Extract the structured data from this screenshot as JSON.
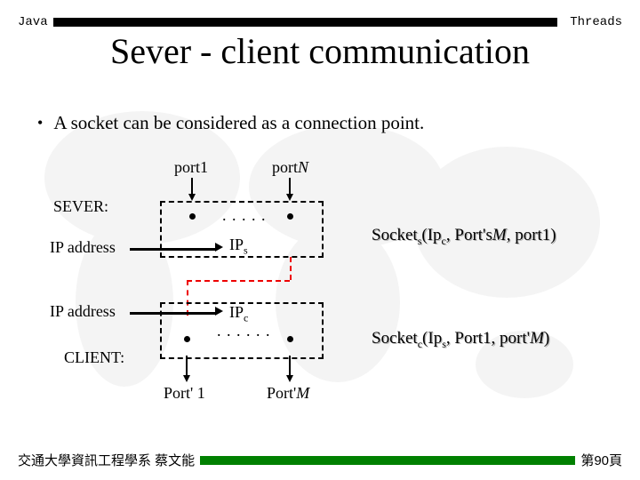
{
  "header": {
    "left": "Java",
    "right": "Threads"
  },
  "title": "Sever - client communication",
  "bullet": "A socket can be considered as a connection point.",
  "labels": {
    "port1": "port1",
    "portN_prefix": "port",
    "portN_suffix": "N",
    "sever": "SEVER:",
    "ip_address": "IP address",
    "ips_prefix": "IP",
    "ips_sub": "s",
    "ipc_prefix": "IP",
    "ipc_sub": "c",
    "client": "CLIENT:",
    "portp1": "Port' 1",
    "portpM_prefix": "Port'",
    "portpM_suffix": "M",
    "dots_top": ". . . . .",
    "dots_bot": ". . . . . ."
  },
  "sockets": {
    "s": {
      "prefix": "Socket",
      "sub1": "s",
      "mid1": "(Ip",
      "sub2": "c",
      "mid2": ", Port's",
      "suf_i": "M",
      "end": ", port1)"
    },
    "c": {
      "prefix": "Socket",
      "sub1": "c",
      "mid1": "(Ip",
      "sub2": "s",
      "mid2": ", Port1, port'",
      "suf_i": "M",
      "end": ")"
    }
  },
  "footer": {
    "left": "交通大學資訊工程學系 蔡文能",
    "right": "第90頁"
  }
}
